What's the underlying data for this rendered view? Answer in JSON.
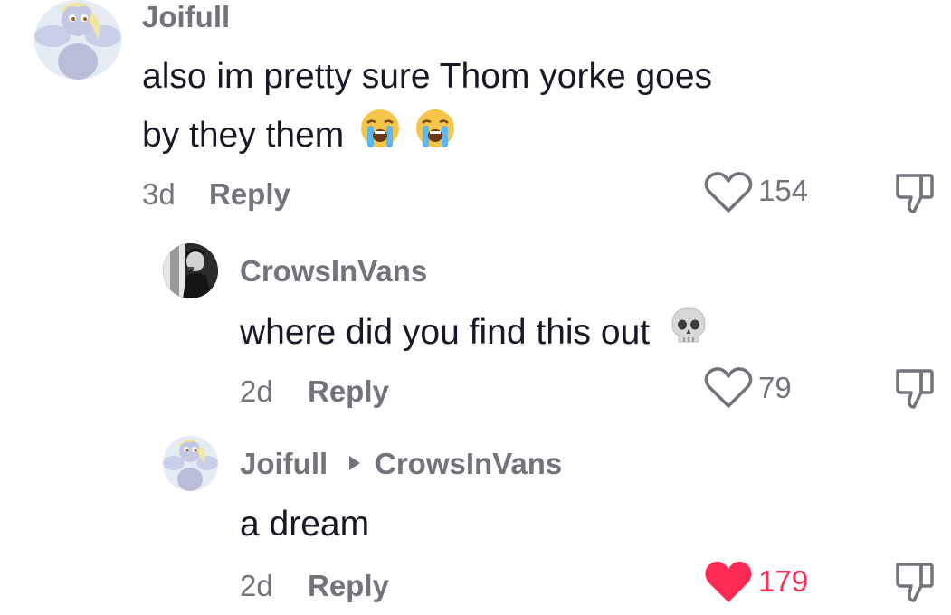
{
  "comments": [
    {
      "username": "Joifull",
      "line1": "also im pretty sure Thom yorke goes",
      "line2": "by they them",
      "emoji": "loudly-crying-face",
      "age": "3d",
      "reply": "Reply",
      "likes": "154",
      "liked": false
    },
    {
      "username": "CrowsInVans",
      "text": "where did you find this out",
      "emoji": "skull",
      "age": "2d",
      "reply": "Reply",
      "likes": "79",
      "liked": false
    },
    {
      "username": "Joifull",
      "reply_to": "CrowsInVans",
      "text": "a dream",
      "age": "2d",
      "reply": "Reply",
      "likes": "179",
      "liked": true
    }
  ],
  "colors": {
    "text": "#161823",
    "muted": "#73747b",
    "liked": "#fe2c55"
  }
}
